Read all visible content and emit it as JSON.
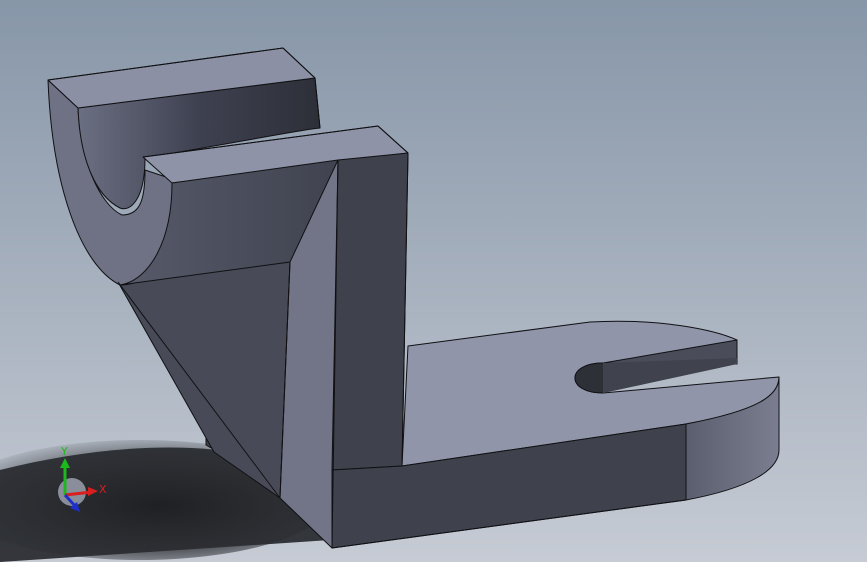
{
  "viewport": {
    "background_top": "#8796a8",
    "background_bottom": "#c6cbd4",
    "shadow_color": "#1e1f22"
  },
  "model": {
    "colors": {
      "light_face": "#8f94a8",
      "mid_face": "#6d7183",
      "dark_face": "#424550",
      "darker_face": "#3a3c45",
      "edge": "#111114"
    }
  },
  "triad": {
    "x_label": "X",
    "y_label": "Y",
    "x_color": "#d81e1e",
    "y_color": "#1db81d",
    "z_color": "#1e2ec8"
  }
}
